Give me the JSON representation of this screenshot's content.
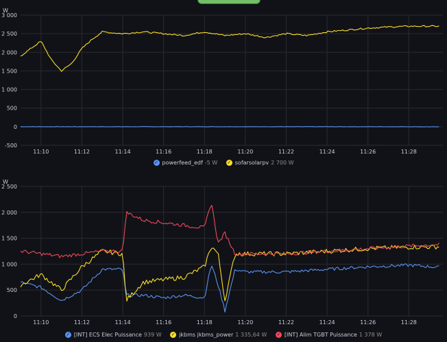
{
  "top_button": "",
  "panel1": {
    "unit": "W",
    "yticks": [
      "3 000",
      "2 500",
      "2 000",
      "1 500",
      "1 000",
      "500",
      "0",
      "-500"
    ],
    "xticks": [
      "11:10",
      "11:12",
      "11:14",
      "11:16",
      "11:18",
      "11:20",
      "11:22",
      "11:24",
      "11:26",
      "11:28"
    ],
    "legend": [
      {
        "name": "powerfeed_edf",
        "value": "-5 W",
        "color": "#5794f2"
      },
      {
        "name": "sofarsolarpv",
        "value": "2 700 W",
        "color": "#fade2a"
      }
    ]
  },
  "panel2": {
    "unit": "W",
    "yticks": [
      "2 500",
      "2 000",
      "1 500",
      "1 000",
      "500",
      "0"
    ],
    "xticks": [
      "11:10",
      "11:12",
      "11:14",
      "11:16",
      "11:18",
      "11:20",
      "11:22",
      "11:24",
      "11:26",
      "11:28"
    ],
    "legend": [
      {
        "name": "[INT] ECS Elec Puissance",
        "value": "939 W",
        "color": "#5794f2"
      },
      {
        "name": "jkbms jkbms_power",
        "value": "1 335,64 W",
        "color": "#fade2a"
      },
      {
        "name": "[INT] Alim TGBT Puissance",
        "value": "1 378 W",
        "color": "#f2495c"
      }
    ]
  },
  "chart_data": [
    {
      "type": "line",
      "title": "",
      "ylabel": "W",
      "ylim": [
        -500,
        3000
      ],
      "x": [
        "11:09",
        "11:10",
        "11:10:30",
        "11:11",
        "11:11:30",
        "11:12",
        "11:12:30",
        "11:13",
        "11:14",
        "11:15",
        "11:16",
        "11:17",
        "11:18",
        "11:19",
        "11:20",
        "11:21",
        "11:22",
        "11:23",
        "11:24",
        "11:25",
        "11:26",
        "11:27",
        "11:28",
        "11:29:30"
      ],
      "series": [
        {
          "name": "powerfeed_edf",
          "values": [
            0,
            0,
            0,
            0,
            0,
            0,
            0,
            0,
            0,
            0,
            0,
            0,
            0,
            0,
            0,
            0,
            0,
            0,
            0,
            0,
            0,
            0,
            0,
            -5
          ]
        },
        {
          "name": "sofarsolarpv",
          "values": [
            1900,
            2300,
            1800,
            1500,
            1700,
            2100,
            2350,
            2550,
            2500,
            2550,
            2500,
            2450,
            2550,
            2450,
            2500,
            2400,
            2500,
            2450,
            2550,
            2600,
            2650,
            2680,
            2700,
            2700
          ]
        }
      ]
    },
    {
      "type": "line",
      "title": "",
      "ylabel": "W",
      "ylim": [
        0,
        2500
      ],
      "x": [
        "11:09",
        "11:10",
        "11:11",
        "11:12",
        "11:13",
        "11:14",
        "11:14:10",
        "11:15",
        "11:16",
        "11:17",
        "11:18",
        "11:18:20",
        "11:18:40",
        "11:19",
        "11:19:30",
        "11:20",
        "11:22",
        "11:24",
        "11:26",
        "11:28",
        "11:29:30"
      ],
      "series": [
        {
          "name": "[INT] ECS Elec Puissance",
          "values": [
            650,
            550,
            300,
            500,
            900,
            900,
            400,
            400,
            350,
            400,
            350,
            1000,
            600,
            100,
            900,
            850,
            850,
            900,
            950,
            980,
            939
          ]
        },
        {
          "name": "jkbms jkbms_power",
          "values": [
            600,
            800,
            500,
            950,
            1250,
            1200,
            300,
            650,
            700,
            750,
            950,
            1350,
            1200,
            300,
            1200,
            1200,
            1200,
            1250,
            1300,
            1330,
            1336
          ]
        },
        {
          "name": "[INT] Alim TGBT Puissance",
          "values": [
            1250,
            1200,
            1150,
            1200,
            1250,
            1250,
            2000,
            1850,
            1800,
            1750,
            1700,
            2200,
            1400,
            1600,
            1200,
            1200,
            1200,
            1250,
            1300,
            1350,
            1378
          ]
        }
      ]
    }
  ]
}
